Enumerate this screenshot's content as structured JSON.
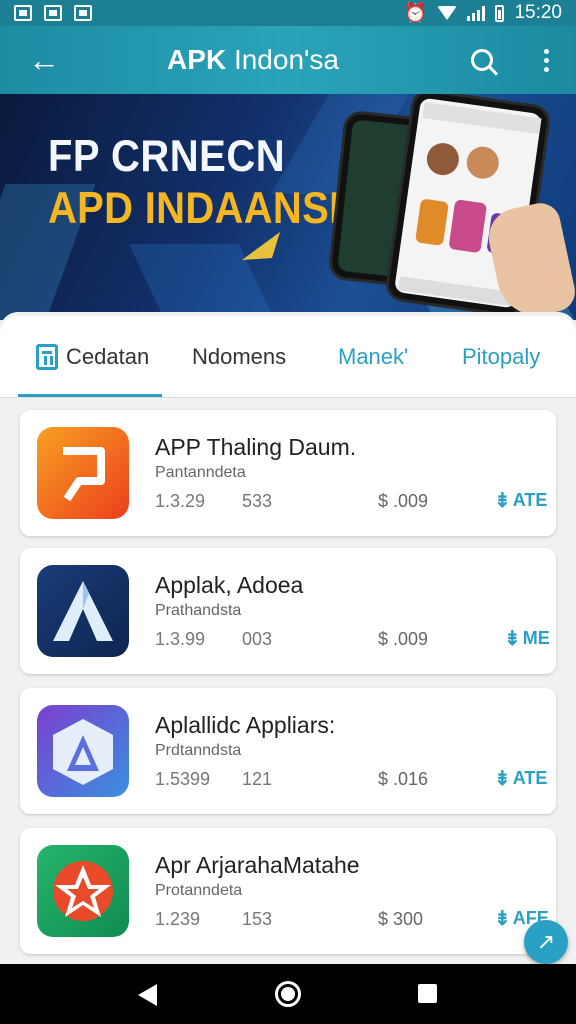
{
  "status_bar": {
    "time": "15:20",
    "icons": [
      "image-icon",
      "photo-icon",
      "plus-box-icon",
      "alarm-icon",
      "wifi-icon",
      "signal-icon",
      "battery-icon"
    ]
  },
  "app_bar": {
    "title_bold": "APK",
    "title_rest": " Indon'sa",
    "icons": [
      "back-arrow-icon",
      "search-icon",
      "more-vert-icon"
    ]
  },
  "banner": {
    "line1": "FP CRNECN",
    "line2": "APD INDAANSIA"
  },
  "tabs": [
    {
      "label": "Cedatan",
      "icon": "calendar-icon",
      "active": true
    },
    {
      "label": "Ndomens",
      "active": false
    },
    {
      "label": "Manek'",
      "active": false
    },
    {
      "label": "Pitopaly",
      "active": false
    }
  ],
  "apps": [
    {
      "name": "APP Thaling Daum.",
      "developer": "Pantanndeta",
      "stat1": "1.3.29",
      "stat2": "533",
      "price": "$ .009",
      "action": "ATE",
      "icon": "app-icon-orange-p"
    },
    {
      "name": "Applak, Adoea",
      "developer": "Prathandsta",
      "stat1": "1.3.99",
      "stat2": "003",
      "price": "$ .009",
      "action": "ME",
      "icon": "app-icon-blue-a"
    },
    {
      "name": "Aplallidc Appliars:",
      "developer": "Prdtanndsta",
      "stat1": "1.5399",
      "stat2": "121",
      "price": "$ .016",
      "action": "ATE",
      "icon": "app-icon-purple-a"
    },
    {
      "name": "Apr ArjarahaMatahe",
      "developer": "Protanndeta",
      "stat1": "1.239",
      "stat2": "153",
      "price": "$ 300",
      "action": "AFE",
      "icon": "app-icon-green-star"
    }
  ],
  "colors": {
    "accent": "#2a9fc3",
    "app_bar": "#1c8ca3",
    "banner_yellow": "#f5b623",
    "banner_dark": "#0b1a3d"
  }
}
